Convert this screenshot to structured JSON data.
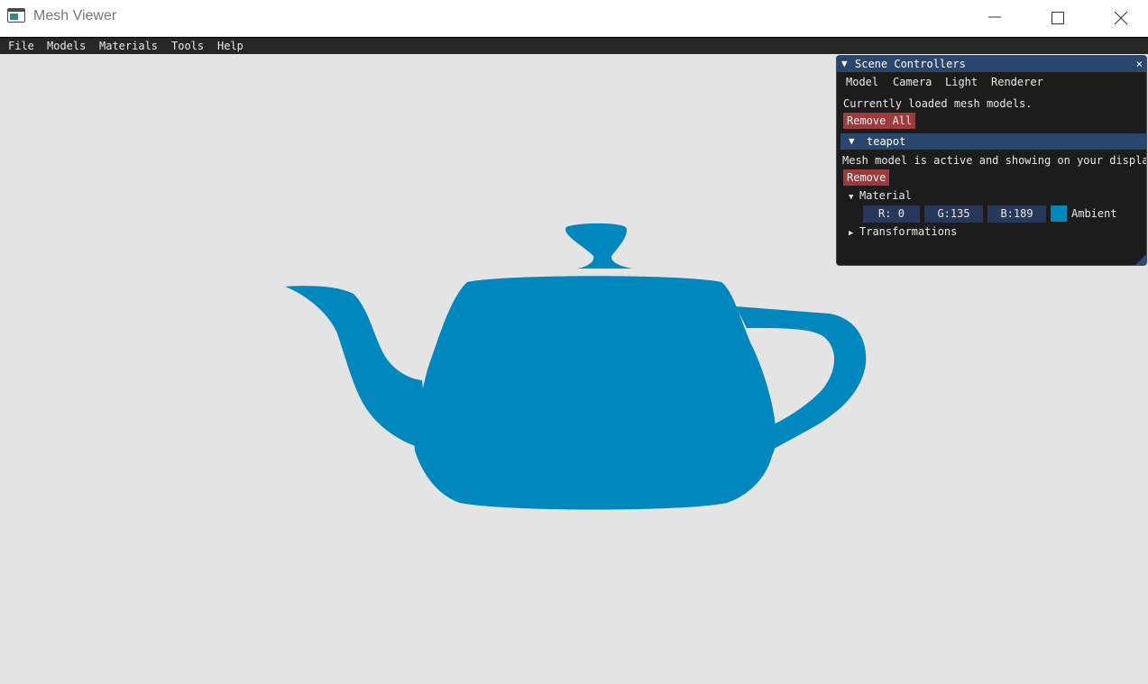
{
  "window": {
    "title": "Mesh Viewer",
    "controls": [
      "minimize-icon",
      "maximize-icon",
      "close-icon"
    ]
  },
  "menu": {
    "items": [
      "File",
      "Models",
      "Materials",
      "Tools",
      "Help"
    ]
  },
  "viewport": {
    "background": "#e4e4e4",
    "model_color": "#0087bd"
  },
  "panel": {
    "title": "Scene Controllers",
    "close_glyph": "×",
    "tabs": [
      "Model",
      "Camera",
      "Light",
      "Renderer"
    ],
    "description": "Currently loaded mesh models.",
    "remove_all_label": "Remove All",
    "model": {
      "name": "teapot",
      "status": "Mesh model is active and showing on your display",
      "remove_label": "Remove",
      "material_label": "Material",
      "fields": {
        "r": "R:  0",
        "g": "G:135",
        "b": "B:189"
      },
      "swatch_color": "#0087bd",
      "swatch_label": "Ambient",
      "transformations_label": "Transformations"
    }
  }
}
